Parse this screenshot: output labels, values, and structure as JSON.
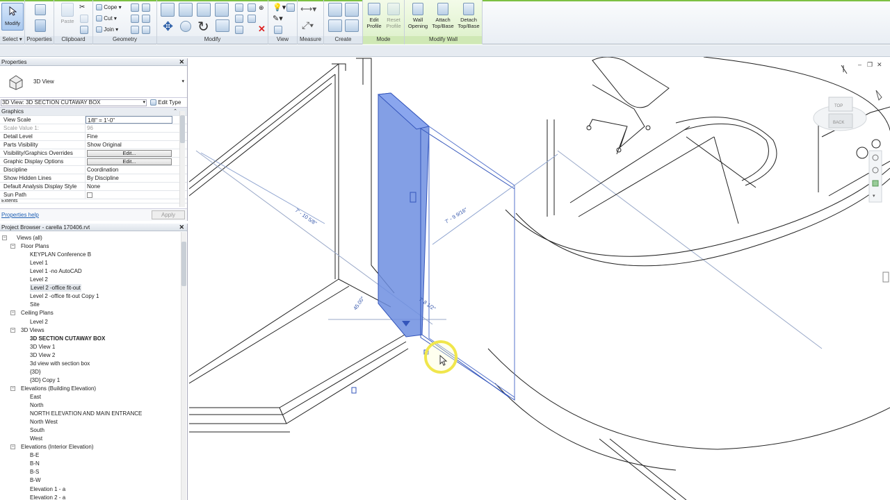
{
  "ribbon": {
    "panels": {
      "select": "Select ▾",
      "properties": "Properties",
      "clipboard": "Clipboard",
      "geometry": "Geometry",
      "modify": "Modify",
      "view": "View",
      "measure": "Measure",
      "create": "Create",
      "mode": "Mode",
      "modify_wall": "Modify Wall"
    },
    "tools": {
      "modify": "Modify",
      "paste": "Paste",
      "cope": "Cope",
      "cut": "Cut",
      "join": "Join",
      "edit_profile_1": "Edit",
      "edit_profile_2": "Profile",
      "reset_profile_1": "Reset",
      "reset_profile_2": "Profile",
      "wall_opening_1": "Wall",
      "wall_opening_2": "Opening",
      "attach_1": "Attach",
      "attach_2": "Top/Base",
      "detach_1": "Detach",
      "detach_2": "Top/Base"
    }
  },
  "properties": {
    "title": "Properties",
    "type_name": "3D View",
    "instance": "3D View: 3D SECTION CUTAWAY BOX",
    "edit_type": "Edit Type",
    "section": "Graphics",
    "rows": [
      {
        "k": "View Scale",
        "v": "1/8\" = 1'-0\""
      },
      {
        "k": "Scale Value    1:",
        "v": "96"
      },
      {
        "k": "Detail Level",
        "v": "Fine"
      },
      {
        "k": "Parts Visibility",
        "v": "Show Original"
      },
      {
        "k": "Visibility/Graphics Overrides",
        "v": "Edit..."
      },
      {
        "k": "Graphic Display Options",
        "v": "Edit..."
      },
      {
        "k": "Discipline",
        "v": "Coordination"
      },
      {
        "k": "Show Hidden Lines",
        "v": "By Discipline"
      },
      {
        "k": "Default Analysis Display Style",
        "v": "None"
      },
      {
        "k": "Sun Path",
        "v": ""
      }
    ],
    "cutoff": "Extents",
    "help": "Properties help",
    "apply": "Apply"
  },
  "browser": {
    "title": "Project Browser - carella 170406.rvt",
    "tree": [
      {
        "label": "Views (all)",
        "lvl": 0,
        "toggle": "-"
      },
      {
        "label": "Floor Plans",
        "lvl": 1,
        "toggle": "-"
      },
      {
        "label": "KEYPLAN Conference B",
        "lvl": 2
      },
      {
        "label": "Level 1",
        "lvl": 2
      },
      {
        "label": "Level 1 -no AutoCAD",
        "lvl": 2
      },
      {
        "label": "Level 2",
        "lvl": 2
      },
      {
        "label": "Level 2 -office fit-out",
        "lvl": 2,
        "hl": true
      },
      {
        "label": "Level 2 -office fit-out Copy 1",
        "lvl": 2
      },
      {
        "label": "Site",
        "lvl": 2
      },
      {
        "label": "Ceiling Plans",
        "lvl": 1,
        "toggle": "-"
      },
      {
        "label": "Level 2",
        "lvl": 2
      },
      {
        "label": "3D Views",
        "lvl": 1,
        "toggle": "-"
      },
      {
        "label": "3D SECTION CUTAWAY BOX",
        "lvl": 2,
        "bold": true
      },
      {
        "label": "3D View 1",
        "lvl": 2
      },
      {
        "label": "3D View 2",
        "lvl": 2
      },
      {
        "label": "3d view with section box",
        "lvl": 2
      },
      {
        "label": "{3D}",
        "lvl": 2
      },
      {
        "label": "{3D} Copy 1",
        "lvl": 2
      },
      {
        "label": "Elevations (Building Elevation)",
        "lvl": 1,
        "toggle": "-"
      },
      {
        "label": "East",
        "lvl": 2
      },
      {
        "label": "North",
        "lvl": 2
      },
      {
        "label": "NORTH ELEVATION AND MAIN ENTRANCE",
        "lvl": 2
      },
      {
        "label": "North West",
        "lvl": 2
      },
      {
        "label": "South",
        "lvl": 2
      },
      {
        "label": "West",
        "lvl": 2
      },
      {
        "label": "Elevations (Interior Elevation)",
        "lvl": 1,
        "toggle": "-"
      },
      {
        "label": "B-E",
        "lvl": 2
      },
      {
        "label": "B-N",
        "lvl": 2
      },
      {
        "label": "B-S",
        "lvl": 2
      },
      {
        "label": "B-W",
        "lvl": 2
      },
      {
        "label": "Elevation 1 - a",
        "lvl": 2
      },
      {
        "label": "Elevation 2 - a",
        "lvl": 2
      }
    ]
  },
  "viewport": {
    "dims": {
      "d1": "7' - 10 5/8\"",
      "d2": "7' - 9 9/16\"",
      "d3": "45.00°",
      "d4": "7' 8 1/2\""
    },
    "viewcube": {
      "top": "TOP",
      "back": "BACK"
    },
    "colors": {
      "wall_fill": "#6d8ee0",
      "wall_edge": "#3355bb",
      "cursor_ring": "#f4ee55"
    }
  }
}
